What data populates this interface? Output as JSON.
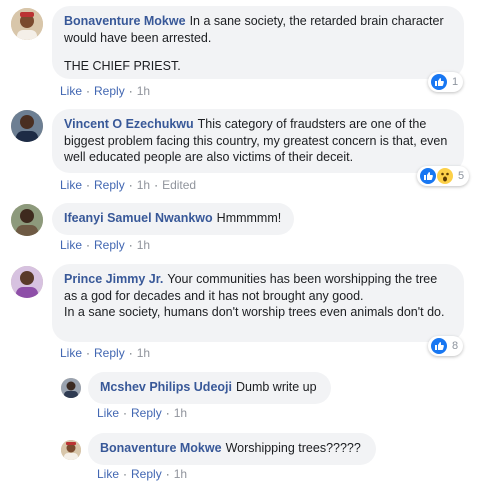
{
  "comments": [
    {
      "author": "Bonaventure Mokwe",
      "text": "In a sane society, the retarded brain character would have been arrested.",
      "text_line2": "THE CHIEF PRIEST.",
      "actions": {
        "like": "Like",
        "reply": "Reply",
        "time": "1h"
      },
      "reaction_count": "1"
    },
    {
      "author": "Vincent O Ezechukwu",
      "text": "This category of fraudsters are one of the biggest problem facing this country, my greatest concern is that, even well educated people are also victims of their deceit.",
      "actions": {
        "like": "Like",
        "reply": "Reply",
        "time": "1h",
        "edited": "Edited"
      },
      "reaction_count": "5"
    },
    {
      "author": "Ifeanyi Samuel Nwankwo",
      "text": "Hmmmmm!",
      "actions": {
        "like": "Like",
        "reply": "Reply",
        "time": "1h"
      }
    },
    {
      "author": "Prince Jimmy Jr.",
      "text": "Your communities has been worshipping the tree as a god for decades and it has not brought any good.",
      "text_line2": "In a sane society, humans don't worship trees even animals don't do.",
      "actions": {
        "like": "Like",
        "reply": "Reply",
        "time": "1h"
      },
      "reaction_count": "8"
    },
    {
      "author": "Mcshev Philips Udeoji",
      "text": "Dumb write up",
      "actions": {
        "like": "Like",
        "reply": "Reply",
        "time": "1h"
      }
    },
    {
      "author": "Bonaventure Mokwe",
      "text": "Worshipping trees?????",
      "actions": {
        "like": "Like",
        "reply": "Reply",
        "time": "1h"
      }
    }
  ],
  "icons": {
    "like": "thumbs-up-icon",
    "wow": "wow-face-icon"
  },
  "colors": {
    "author_link": "#385898",
    "action_link": "#4267b2",
    "bubble_bg": "#f2f3f5",
    "like_blue": "#1877f2"
  }
}
